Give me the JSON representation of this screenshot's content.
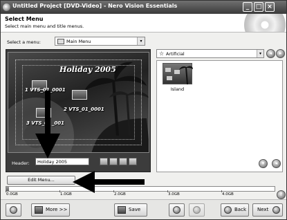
{
  "window": {
    "title": "Untitled Project [DVD-Video] - Nero Vision Essentials",
    "minimize_glyph": "_",
    "maximize_glyph": "□",
    "close_glyph": "×"
  },
  "header": {
    "title": "Select Menu",
    "subtitle": "Select main menu and title menus."
  },
  "menu_selector": {
    "label": "Select a menu:",
    "value": "Main Menu",
    "dropdown_glyph": "▾"
  },
  "preview": {
    "title": "Holiday 2005",
    "buttons": [
      "1  VTS_01_0001",
      "2  VTS_01_0001",
      "3  VTS_0_ _001"
    ]
  },
  "header_field": {
    "label": "Header:",
    "value": "Holiday 2005"
  },
  "theme_selector": {
    "value": "Artificial",
    "icon": "star-icon",
    "icon_glyph": "☆",
    "dropdown_glyph": "▾",
    "items": [
      {
        "label": "Island"
      }
    ]
  },
  "edit_menu": {
    "label": "Edit Menu..."
  },
  "capacity": {
    "fill_fraction": 0.01,
    "ticks": [
      "0.0GB",
      "1.0GB",
      "2.0GB",
      "3.0GB",
      "4.0GB"
    ],
    "help_glyph": "?"
  },
  "bottom": {
    "more_label": "More >>",
    "save_label": "Save",
    "back_label": "Back",
    "next_label": "Next"
  },
  "colors": {
    "titlebar_start": "#707070",
    "titlebar_end": "#3a3a3a",
    "preview_frame": "#3c3c3c",
    "annotation_arrow": "#000000"
  }
}
